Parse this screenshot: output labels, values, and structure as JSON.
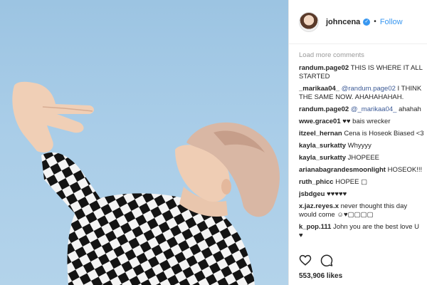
{
  "header": {
    "username": "johncena",
    "separator": "•",
    "follow_label": "Follow"
  },
  "comments": {
    "load_more": "Load more comments",
    "items": [
      {
        "user": "randum.page02",
        "mention": "",
        "text": "THIS IS WHERE IT ALL STARTED"
      },
      {
        "user": "_marikaa04_",
        "mention": "@randum.page02",
        "text": "I THINK THE SAME NOW. AHAHAHAHAH."
      },
      {
        "user": "randum.page02",
        "mention": "@_marikaa04_",
        "text": "ahahah"
      },
      {
        "user": "wwe.grace01",
        "mention": "",
        "text": "♥♥ bais wrecker"
      },
      {
        "user": "itzeel_hernan",
        "mention": "",
        "text": "Cena is Hoseok Biased <3"
      },
      {
        "user": "kayla_surkatty",
        "mention": "",
        "text": "Whyyyy"
      },
      {
        "user": "kayla_surkatty",
        "mention": "",
        "text": "JHOPEEE"
      },
      {
        "user": "arianabagrandesmoonlight",
        "mention": "",
        "text": "HOSEOK!!!"
      },
      {
        "user": "ruth_phicc",
        "mention": "",
        "text": "HOPEE ▢"
      },
      {
        "user": "jsbdgeu",
        "mention": "",
        "text": "♥♥♥♥♥"
      },
      {
        "user": "x.jaz.reyes.x",
        "mention": "",
        "text": "never thought this day would come ☺♥▢▢▢▢"
      },
      {
        "user": "k_pop.111",
        "mention": "",
        "text": "John you are the best love U ♥"
      }
    ]
  },
  "footer": {
    "likes": "553,906 likes"
  },
  "icons": {
    "like": "heart-icon",
    "comment": "comment-icon",
    "verified": "verified-badge-icon"
  },
  "colors": {
    "link": "#3897f0",
    "mention": "#3c5a96",
    "sky": "#a9cde8"
  }
}
